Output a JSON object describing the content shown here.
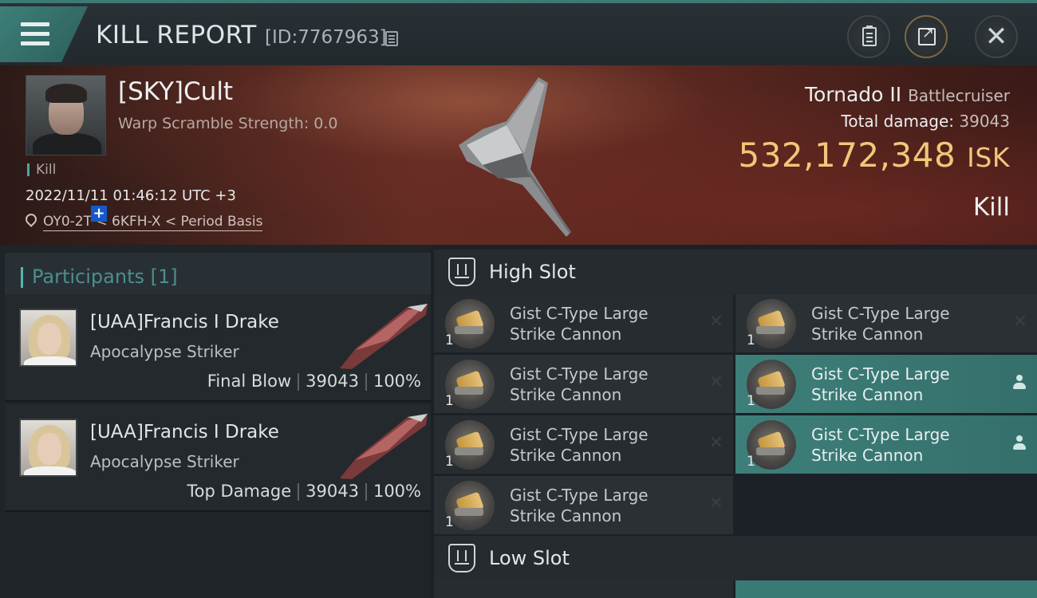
{
  "header": {
    "title": "KILL REPORT",
    "id_text": "[ID:7767963]"
  },
  "victim": {
    "name": "[SKY]Cult",
    "scramble": "Warp Scramble Strength: 0.0",
    "kill_tag": "Kill",
    "timestamp": "2022/11/11 01:46:12 UTC +3",
    "location": "OY0-2T < 6KFH-X < Period Basis",
    "ship_name": "Tornado II",
    "ship_class": "Battlecruiser",
    "total_damage_label": "Total damage:",
    "total_damage": "39043",
    "isk_value": "532,172,348",
    "isk_unit": "ISK",
    "result": "Kill"
  },
  "participants": {
    "title": "Participants [1]",
    "items": [
      {
        "name": "[UAA]Francis I Drake",
        "ship": "Apocalypse Striker",
        "role": "Final Blow",
        "damage": "39043",
        "percent": "100%"
      },
      {
        "name": "[UAA]Francis I Drake",
        "ship": "Apocalypse Striker",
        "role": "Top Damage",
        "damage": "39043",
        "percent": "100%"
      }
    ]
  },
  "slots": {
    "high": {
      "title": "High Slot",
      "modules": [
        {
          "qty": "1",
          "line1": "Gist C-Type Large",
          "line2": "Strike Cannon",
          "state": "destroyed"
        },
        {
          "qty": "1",
          "line1": "Gist C-Type Large",
          "line2": "Strike Cannon",
          "state": "destroyed"
        },
        {
          "qty": "1",
          "line1": "Gist C-Type Large",
          "line2": "Strike Cannon",
          "state": "destroyed"
        },
        {
          "qty": "1",
          "line1": "Gist C-Type Large",
          "line2": "Strike Cannon",
          "state": "dropped"
        },
        {
          "qty": "1",
          "line1": "Gist C-Type Large",
          "line2": "Strike Cannon",
          "state": "destroyed"
        },
        {
          "qty": "1",
          "line1": "Gist C-Type Large",
          "line2": "Strike Cannon",
          "state": "dropped"
        },
        {
          "qty": "1",
          "line1": "Gist C-Type Large",
          "line2": "Strike Cannon",
          "state": "destroyed"
        }
      ]
    },
    "low": {
      "title": "Low Slot"
    }
  },
  "icons": {
    "destroyed": "close-x-icon",
    "dropped": "person-icon"
  },
  "colors": {
    "accent": "#3e7f7a",
    "isk": "#f1c77a"
  }
}
